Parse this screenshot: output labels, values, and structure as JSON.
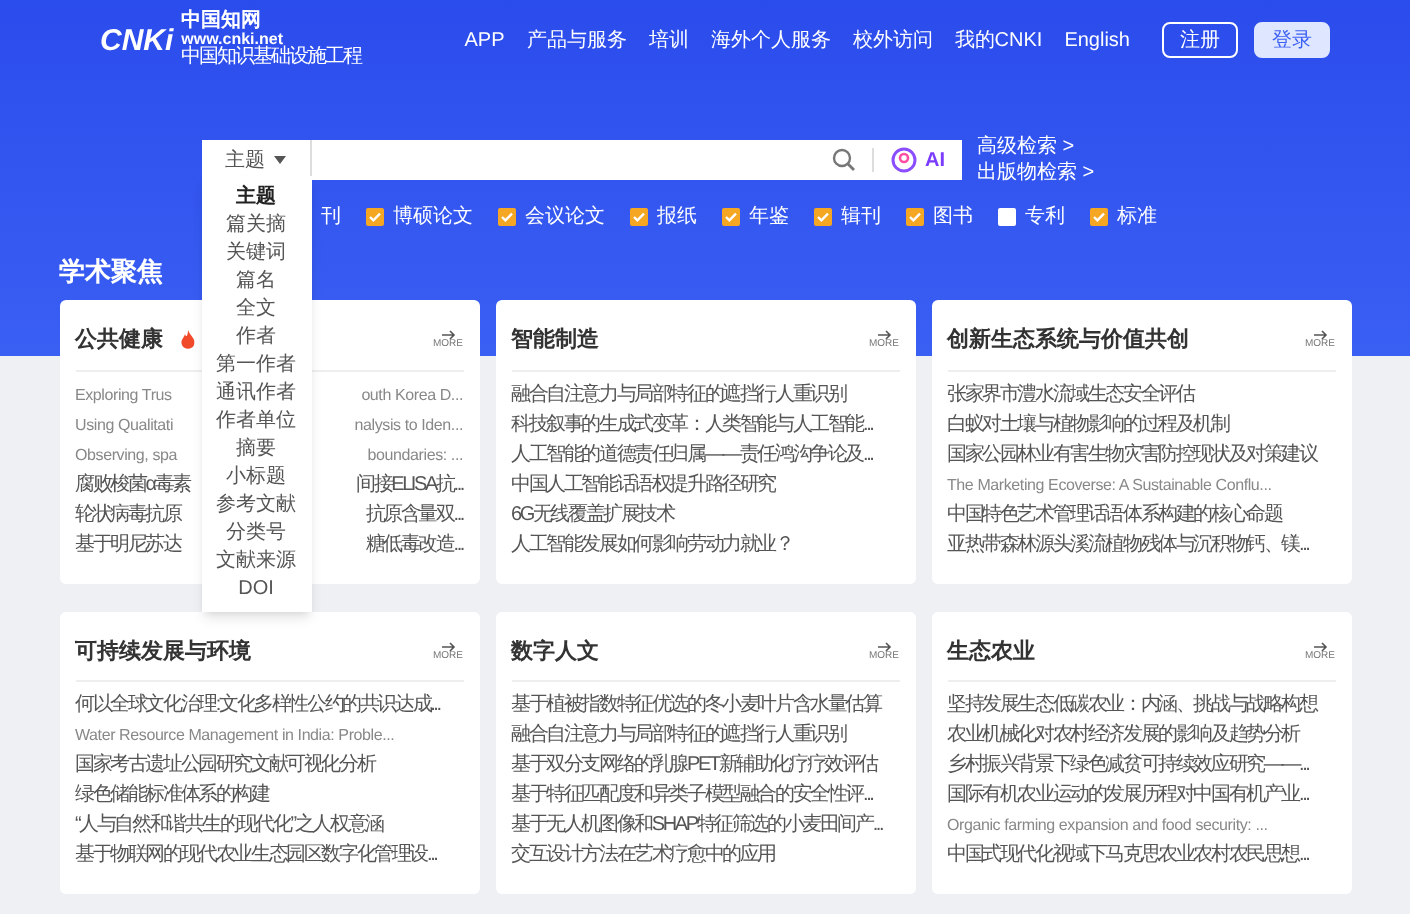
{
  "logo": {
    "mark": "CNKi",
    "name": "中国知网",
    "url": "www.cnki.net",
    "slogan": "中国知识基础设施工程"
  },
  "nav": [
    "APP",
    "产品与服务",
    "培训",
    "海外个人服务",
    "校外访问",
    "我的CNKI",
    "English"
  ],
  "buttons": [
    {
      "label": "注册",
      "kind": "outline"
    },
    {
      "label": "登录",
      "kind": "filled"
    }
  ],
  "search": {
    "field": "主题",
    "links": [
      "高级检索 >",
      "出版物检索 >"
    ],
    "ai": "AI",
    "dropdown": [
      {
        "label": "主题",
        "selected": true
      },
      {
        "label": "篇关摘",
        "selected": false
      },
      {
        "label": "关键词",
        "selected": false
      },
      {
        "label": "篇名",
        "selected": false
      },
      {
        "label": "全文",
        "selected": false
      },
      {
        "label": "作者",
        "selected": false
      },
      {
        "label": "第一作者",
        "selected": false
      },
      {
        "label": "通讯作者",
        "selected": false
      },
      {
        "label": "作者单位",
        "selected": false
      },
      {
        "label": "摘要",
        "selected": false
      },
      {
        "label": "小标题",
        "selected": false
      },
      {
        "label": "参考文献",
        "selected": false
      },
      {
        "label": "分类号",
        "selected": false
      },
      {
        "label": "文献来源",
        "selected": false
      },
      {
        "label": "DOI",
        "selected": false
      }
    ],
    "cut_source": "刊",
    "sources": [
      {
        "label": "博硕论文",
        "checked": true
      },
      {
        "label": "会议论文",
        "checked": true
      },
      {
        "label": "报纸",
        "checked": true
      },
      {
        "label": "年鉴",
        "checked": true
      },
      {
        "label": "辑刊",
        "checked": true
      },
      {
        "label": "图书",
        "checked": true
      },
      {
        "label": "专利",
        "checked": false
      },
      {
        "label": "标准",
        "checked": true
      }
    ]
  },
  "section_title": "学术聚焦",
  "cards": [
    {
      "title": "公共健康",
      "hot": true,
      "more": "MORE",
      "items": [
        {
          "kind": "latin",
          "start": "Exploring Trus",
          "end": "outh Korea D..."
        },
        {
          "kind": "latin",
          "start": "Using Qualitati",
          "end": "nalysis to Iden..."
        },
        {
          "kind": "latin",
          "start": "Observing, spa",
          "end": "boundaries: ..."
        },
        {
          "kind": "cjk",
          "start": "腐败梭菌α毒素",
          "end": "间接ELISA抗..."
        },
        {
          "kind": "cjk",
          "start": "轮状病毒抗原",
          "end": "抗原含量双..."
        },
        {
          "kind": "cjk",
          "start": "基于明尼苏达",
          "end": "糖低毒改造..."
        }
      ]
    },
    {
      "title": "智能制造",
      "hot": false,
      "more": "MORE",
      "items": [
        {
          "kind": "cjk",
          "text": "融合自注意力与局部特征的遮挡行人重识别"
        },
        {
          "kind": "cjk",
          "text": "科技叙事的生成式变革：人类智能与人工智能..."
        },
        {
          "kind": "cjk",
          "text": "人工智能的道德责任归属——责任鸿沟争论及..."
        },
        {
          "kind": "cjk",
          "text": "中国人工智能话语权提升路径研究"
        },
        {
          "kind": "cjk",
          "text": "6G无线覆盖扩展技术"
        },
        {
          "kind": "cjk",
          "text": "人工智能发展如何影响劳动力就业？"
        }
      ]
    },
    {
      "title": "创新生态系统与价值共创",
      "hot": false,
      "more": "MORE",
      "items": [
        {
          "kind": "cjk",
          "text": "张家界市澧水流域生态安全评估"
        },
        {
          "kind": "cjk",
          "text": "白蚁对土壤与植物影响的过程及机制"
        },
        {
          "kind": "cjk",
          "text": "国家公园林业有害生物灾害防控现状及对策建议"
        },
        {
          "kind": "latin",
          "text": "The Marketing Ecoverse: A Sustainable Conflu..."
        },
        {
          "kind": "cjk",
          "text": "中国特色艺术管理话语体系构建的核心命题"
        },
        {
          "kind": "cjk",
          "text": "亚热带森林源头溪流植物残体与沉积物钙、镁..."
        }
      ]
    },
    {
      "title": "可持续发展与环境",
      "hot": false,
      "more": "MORE",
      "items": [
        {
          "kind": "cjk",
          "text": "何以全球文化治理:文化多样性公约的共识达成..."
        },
        {
          "kind": "latin",
          "text": "Water Resource Management in India: Proble..."
        },
        {
          "kind": "cjk",
          "text": "国家考古遗址公园研究文献可视化分析"
        },
        {
          "kind": "cjk",
          "text": "绿色储能标准体系的构建"
        },
        {
          "kind": "cjk",
          "text": "“人与自然和谐共生的现代化”之人权意涵"
        },
        {
          "kind": "cjk",
          "text": "基于物联网的现代农业生态园区数字化管理设..."
        }
      ]
    },
    {
      "title": "数字人文",
      "hot": false,
      "more": "MORE",
      "items": [
        {
          "kind": "cjk",
          "text": "基于植被指数特征优选的冬小麦叶片含水量估算"
        },
        {
          "kind": "cjk",
          "text": "融合自注意力与局部特征的遮挡行人重识别"
        },
        {
          "kind": "cjk",
          "text": "基于双分支网络的乳腺PET新辅助化疗疗效评估"
        },
        {
          "kind": "cjk",
          "text": "基于特征匹配度和异类子模型融合的安全性评..."
        },
        {
          "kind": "cjk",
          "text": "基于无人机图像和SHAP特征筛选的小麦田间产..."
        },
        {
          "kind": "cjk",
          "text": "交互设计方法在艺术疗愈中的应用"
        }
      ]
    },
    {
      "title": "生态农业",
      "hot": false,
      "more": "MORE",
      "items": [
        {
          "kind": "cjk",
          "text": "坚持发展生态低碳农业：内涵、挑战与战略构想"
        },
        {
          "kind": "cjk",
          "text": "农业机械化对农村经济发展的影响及趋势分析"
        },
        {
          "kind": "cjk",
          "text": "乡村振兴背景下绿色减贫可持续效应研究——..."
        },
        {
          "kind": "cjk",
          "text": "国际有机农业运动的发展历程对中国有机产业..."
        },
        {
          "kind": "latin",
          "text": "Organic farming expansion and food security: ..."
        },
        {
          "kind": "cjk",
          "text": "中国式现代化视域下马克思农业农村农民思想..."
        }
      ]
    }
  ]
}
